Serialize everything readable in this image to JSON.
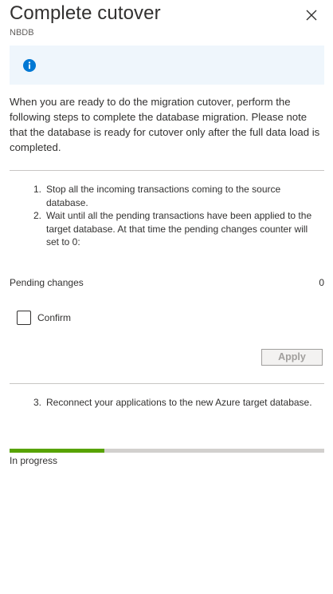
{
  "header": {
    "title": "Complete cutover",
    "subtitle": "NBDB"
  },
  "info_banner": {
    "icon": "info-icon"
  },
  "description": "When you are ready to do the migration cutover, perform the following steps to complete the database migration. Please note that the database is ready for cutover only after the full data load is completed.",
  "steps": [
    {
      "num": "1.",
      "text": "Stop all the incoming transactions coming to the source database."
    },
    {
      "num": "2.",
      "text": "Wait until all the pending transactions have been applied to the target database. At that time the pending changes counter will set to 0:"
    }
  ],
  "pending": {
    "label": "Pending changes",
    "value": "0"
  },
  "confirm": {
    "label": "Confirm",
    "checked": false
  },
  "apply_button": {
    "label": "Apply",
    "disabled": true
  },
  "step3": {
    "num": "3.",
    "text": "Reconnect your applications to the new Azure target database."
  },
  "progress": {
    "fraction": 0.3,
    "label": "In progress",
    "fill_color": "#57a300"
  },
  "colors": {
    "accent": "#0078d4",
    "banner_bg": "#eff6fc"
  }
}
